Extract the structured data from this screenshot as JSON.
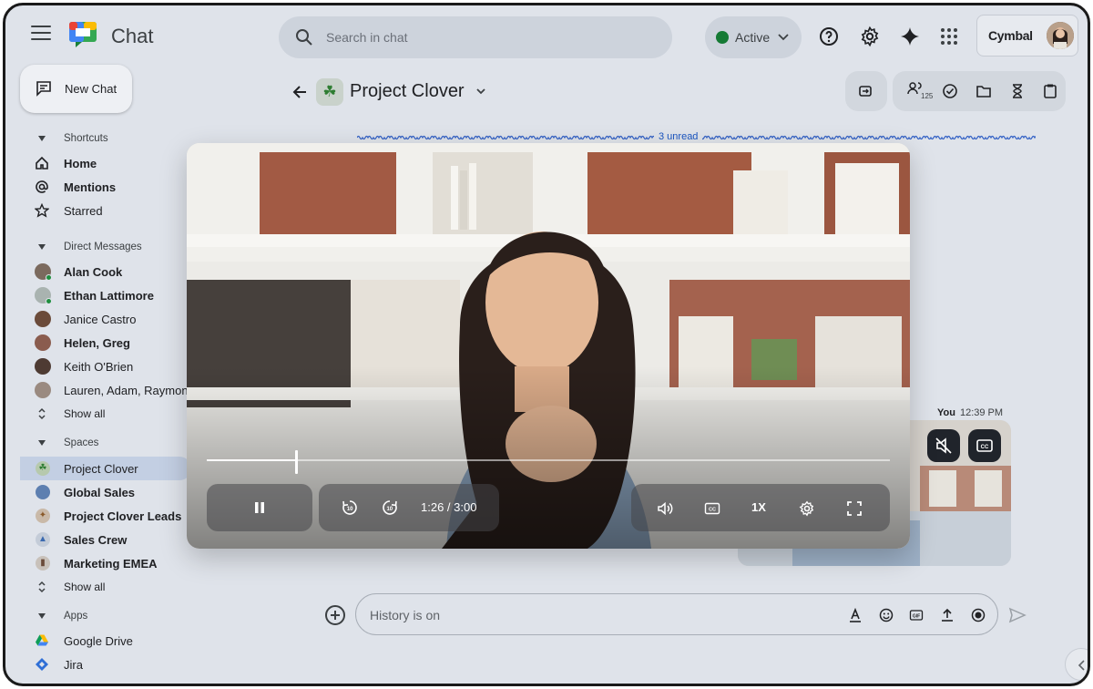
{
  "app": {
    "name": "Chat"
  },
  "search": {
    "placeholder": "Search in chat"
  },
  "status": {
    "label": "Active",
    "color": "#157a34"
  },
  "profile": {
    "brand": "Cymbal"
  },
  "sidebar": {
    "new_chat": "New Chat",
    "shortcuts": {
      "title": "Shortcuts",
      "items": [
        {
          "label": "Home",
          "icon": "home-icon"
        },
        {
          "label": "Mentions",
          "icon": "at-icon"
        },
        {
          "label": "Starred",
          "icon": "star-icon"
        }
      ]
    },
    "direct_messages": {
      "title": "Direct Messages",
      "items": [
        {
          "label": "Alan Cook"
        },
        {
          "label": "Ethan Lattimore"
        },
        {
          "label": "Janice Castro"
        },
        {
          "label": "Helen, Greg"
        },
        {
          "label": "Keith O'Brien"
        },
        {
          "label": "Lauren, Adam, Raymond"
        }
      ],
      "show_all": "Show all"
    },
    "spaces": {
      "title": "Spaces",
      "items": [
        {
          "label": "Project Clover"
        },
        {
          "label": "Global Sales"
        },
        {
          "label": "Project Clover Leads"
        },
        {
          "label": "Sales Crew"
        },
        {
          "label": "Marketing EMEA"
        }
      ],
      "show_all": "Show all"
    },
    "apps": {
      "title": "Apps",
      "items": [
        {
          "label": "Google Drive"
        },
        {
          "label": "Jira"
        }
      ]
    }
  },
  "space": {
    "title": "Project Clover",
    "members_count": "125",
    "unread": "3 unread"
  },
  "message": {
    "sender": "You",
    "time": "12:39 PM"
  },
  "video": {
    "progress": 0.13,
    "time": "1:26 / 3:00",
    "speed": "1X",
    "skip_seconds": "10"
  },
  "composer": {
    "placeholder": "History is on"
  }
}
